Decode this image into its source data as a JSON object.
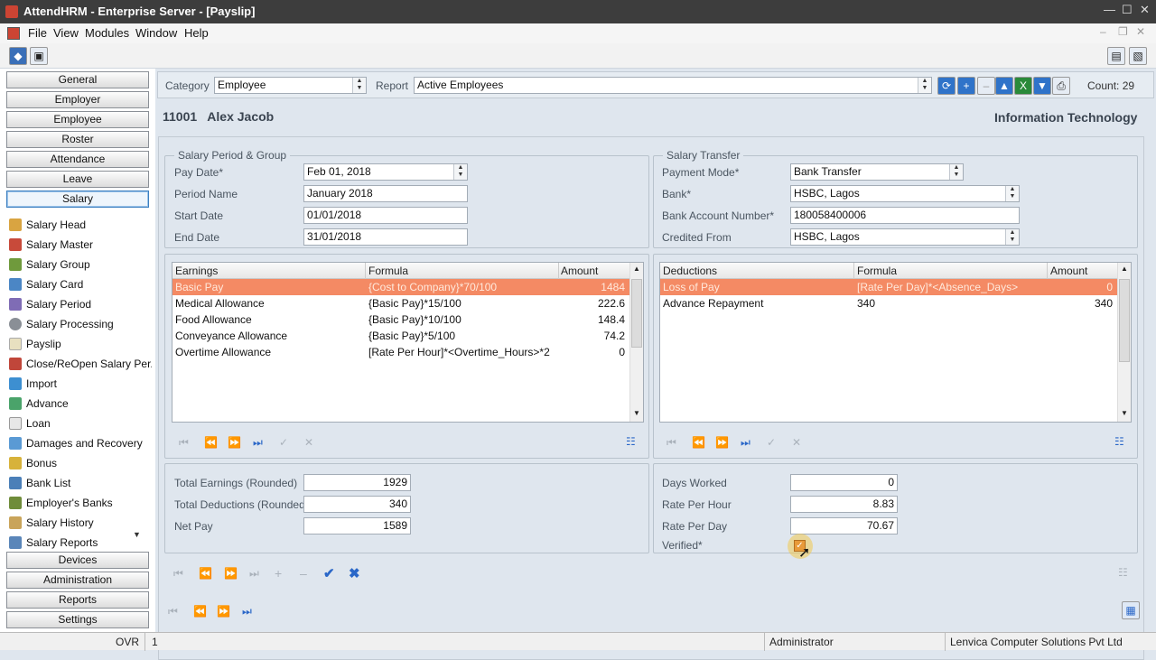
{
  "window": {
    "title": "AttendHRM - Enterprise Server - [Payslip]",
    "min": "—",
    "max": "☐",
    "close": "✕"
  },
  "menu": [
    "File",
    "View",
    "Modules",
    "Window",
    "Help"
  ],
  "nav": {
    "top": [
      "General",
      "Employer",
      "Employee",
      "Roster",
      "Attendance",
      "Leave",
      "Salary"
    ],
    "items": [
      "Salary Head",
      "Salary Master",
      "Salary Group",
      "Salary Card",
      "Salary Period",
      "Salary Processing",
      "Payslip",
      "Close/ReOpen Salary Per...",
      "Import",
      "Advance",
      "Loan",
      "Damages and Recovery",
      "Bonus",
      "Bank List",
      "Employer's Banks",
      "Salary History",
      "Salary Reports"
    ],
    "bottom": [
      "Devices",
      "Administration",
      "Reports",
      "Settings"
    ]
  },
  "filter": {
    "category_label": "Category",
    "category_value": "Employee",
    "report_label": "Report",
    "report_value": "Active Employees",
    "count": "Count: 29"
  },
  "employee": {
    "id_name": "11001   Alex Jacob",
    "department": "Information Technology"
  },
  "period": {
    "title": "Salary Period & Group",
    "pay_date_label": "Pay Date*",
    "pay_date": "Feb 01, 2018",
    "period_name_label": "Period Name",
    "period_name": "January 2018",
    "start_label": "Start Date",
    "start": "01/01/2018",
    "end_label": "End Date",
    "end": "31/01/2018"
  },
  "transfer": {
    "title": "Salary Transfer",
    "mode_label": "Payment Mode*",
    "mode": "Bank Transfer",
    "bank_label": "Bank*",
    "bank": "HSBC, Lagos",
    "account_label": "Bank Account Number*",
    "account": "180058400006",
    "credited_label": "Credited From",
    "credited": "HSBC, Lagos"
  },
  "earnings": {
    "headers": [
      "Earnings",
      "Formula",
      "Amount"
    ],
    "rows": [
      [
        "Basic Pay",
        "{Cost to Company}*70/100",
        "1484"
      ],
      [
        "Medical Allowance",
        "{Basic Pay}*15/100",
        "222.6"
      ],
      [
        "Food Allowance",
        "{Basic Pay}*10/100",
        "148.4"
      ],
      [
        "Conveyance Allowance",
        "{Basic Pay}*5/100",
        "74.2"
      ],
      [
        "Overtime Allowance",
        "[Rate Per Hour]*<Overtime_Hours>*2",
        "0"
      ]
    ]
  },
  "deductions": {
    "headers": [
      "Deductions",
      "Formula",
      "Amount"
    ],
    "rows": [
      [
        "Loss of Pay",
        "[Rate Per Day]*<Absence_Days>",
        "0"
      ],
      [
        "Advance Repayment",
        "340",
        "340"
      ]
    ]
  },
  "totals": {
    "earnings_label": "Total Earnings (Rounded)",
    "earnings": "1929",
    "deductions_label": "Total Deductions (Rounded)",
    "deductions": "340",
    "net_label": "Net Pay",
    "net": "1589"
  },
  "stats": {
    "days_label": "Days Worked",
    "days": "0",
    "hour_label": "Rate Per Hour",
    "hour": "8.83",
    "day_label": "Rate Per Day",
    "day": "70.67",
    "verified_label": "Verified*",
    "verified": true
  },
  "status": {
    "mode": "OVR",
    "line": "1",
    "user": "Administrator",
    "company": "Lenvica Computer Solutions Pvt Ltd"
  },
  "colors": {
    "selected_row": "#f48a64",
    "accent": "#2a67c8"
  }
}
